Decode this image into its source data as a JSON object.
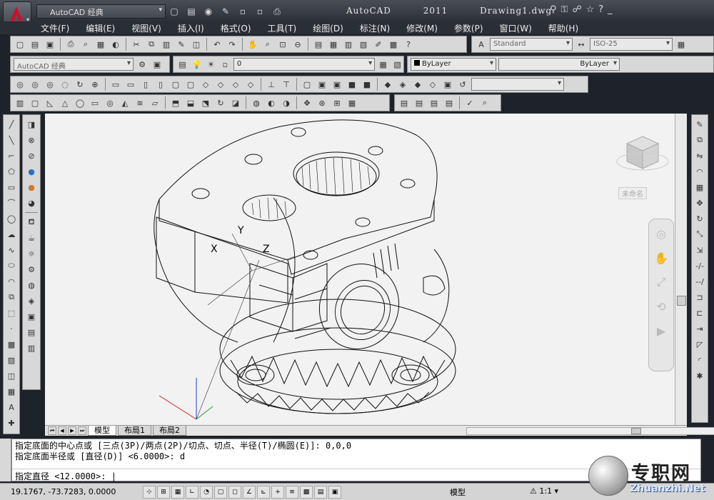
{
  "app": {
    "title": "AutoCAD 2011",
    "document": "Drawing1.dwg",
    "workspace": "AutoCAD 经典"
  },
  "menu": [
    "文件(F)",
    "编辑(E)",
    "视图(V)",
    "插入(I)",
    "格式(O)",
    "工具(T)",
    "绘图(D)",
    "标注(N)",
    "修改(M)",
    "参数(P)",
    "窗口(W)",
    "帮助(H)"
  ],
  "styles": {
    "text_style": "Standard",
    "dim_style": "ISO-25",
    "workspace2": "AutoCAD 经典",
    "layer_value": "0",
    "color": "ByLayer",
    "linetype": "ByLayer"
  },
  "viewcube": {
    "label": "未命名"
  },
  "tabs": [
    "模型",
    "布局1",
    "布局2"
  ],
  "command": {
    "line1": "指定底面的中心点或 [三点(3P)/两点(2P)/切点、切点、半径(T)/椭圆(E)]: 0,0,0",
    "line2": "指定底面半径或 [直径(D)] <6.0000>: d",
    "prompt": "指定直径 <12.0000>: |"
  },
  "status": {
    "coordinates": "19.1767,  -73.7283, 0.0000",
    "model": "模型",
    "scale": "1:1"
  },
  "watermark": {
    "text": "专职网",
    "sub": "Zhuanzhi.Net"
  },
  "ucs": {
    "x": "X",
    "y": "Y",
    "z": "Z"
  },
  "colors": {
    "titlebar": "#2b2f36",
    "canvas": "#f2f2f2",
    "accent_red": "#c8102e"
  }
}
